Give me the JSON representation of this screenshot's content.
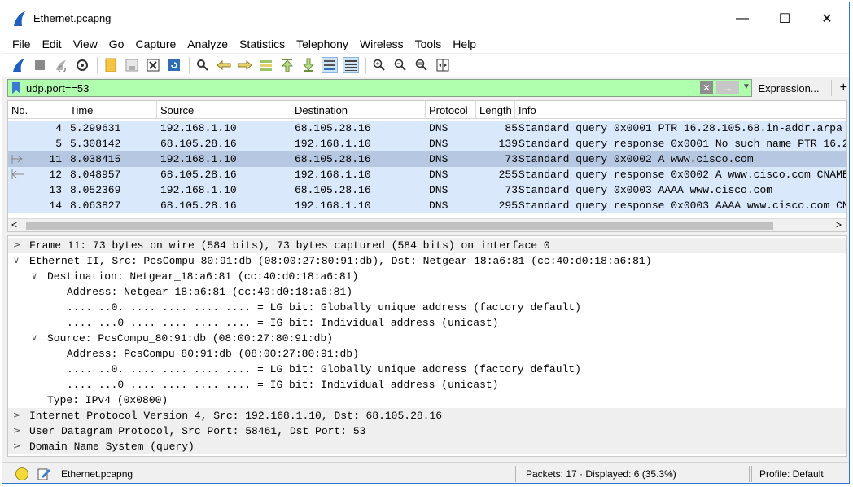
{
  "window": {
    "title": "Ethernet.pcapng",
    "minimize_glyph": "—",
    "maximize_glyph": "☐",
    "close_glyph": "✕"
  },
  "menu": {
    "items": [
      "File",
      "Edit",
      "View",
      "Go",
      "Capture",
      "Analyze",
      "Statistics",
      "Telephony",
      "Wireless",
      "Tools",
      "Help"
    ]
  },
  "toolbar": {
    "icons": [
      "shark-fin-start-icon",
      "stop-icon",
      "restart-icon",
      "capture-options-icon",
      "open-file-icon",
      "save-file-icon",
      "close-file-icon",
      "reload-icon",
      "find-packet-icon",
      "go-back-icon",
      "go-forward-icon",
      "go-to-packet-icon",
      "go-first-icon",
      "go-last-icon",
      "auto-scroll-icon",
      "colorize-icon",
      "zoom-in-icon",
      "zoom-out-icon",
      "normal-size-icon",
      "resize-columns-icon"
    ]
  },
  "filter": {
    "value": "udp.port==53",
    "field_color": "#afffaf",
    "clear_glyph": "✕",
    "apply_glyph": "→",
    "dropdown_glyph": "▼",
    "expression_label": "Expression...",
    "add_glyph": "+"
  },
  "packet_list": {
    "columns": [
      "No.",
      "Time",
      "Source",
      "Destination",
      "Protocol",
      "Length",
      "Info"
    ],
    "row_color": "#dae8fc",
    "selected_color": "#b6c8e1",
    "rows": [
      {
        "no": "4",
        "time": "5.299631",
        "src": "192.168.1.10",
        "dst": "68.105.28.16",
        "proto": "DNS",
        "len": "85",
        "info": "Standard query 0x0001 PTR 16.28.105.68.in-addr.arpa"
      },
      {
        "no": "5",
        "time": "5.308142",
        "src": "68.105.28.16",
        "dst": "192.168.1.10",
        "proto": "DNS",
        "len": "139",
        "info": "Standard query response 0x0001 No such name PTR 16.2"
      },
      {
        "no": "11",
        "time": "8.038415",
        "src": "192.168.1.10",
        "dst": "68.105.28.16",
        "proto": "DNS",
        "len": "73",
        "info": "Standard query 0x0002 A www.cisco.com"
      },
      {
        "no": "12",
        "time": "8.048957",
        "src": "68.105.28.16",
        "dst": "192.168.1.10",
        "proto": "DNS",
        "len": "255",
        "info": "Standard query response 0x0002 A www.cisco.com CNAME"
      },
      {
        "no": "13",
        "time": "8.052369",
        "src": "192.168.1.10",
        "dst": "68.105.28.16",
        "proto": "DNS",
        "len": "73",
        "info": "Standard query 0x0003 AAAA www.cisco.com"
      },
      {
        "no": "14",
        "time": "8.063827",
        "src": "68.105.28.16",
        "dst": "192.168.1.10",
        "proto": "DNS",
        "len": "295",
        "info": "Standard query response 0x0003 AAAA www.cisco.com CN"
      }
    ],
    "scroll_left_glyph": "<",
    "scroll_right_glyph": ">"
  },
  "details": {
    "lines": [
      {
        "toggle": ">",
        "text": "Frame 11: 73 bytes on wire (584 bits), 73 bytes captured (584 bits) on interface 0"
      },
      {
        "toggle": "∨",
        "text": "Ethernet II, Src: PcsCompu_80:91:db (08:00:27:80:91:db), Dst: Netgear_18:a6:81 (cc:40:d0:18:a6:81)"
      },
      {
        "toggle": "∨",
        "text": "Destination: Netgear_18:a6:81 (cc:40:d0:18:a6:81)"
      },
      {
        "toggle": "",
        "text": "Address: Netgear_18:a6:81 (cc:40:d0:18:a6:81)"
      },
      {
        "toggle": "",
        "text": ".... ..0. .... .... .... .... = LG bit: Globally unique address (factory default)"
      },
      {
        "toggle": "",
        "text": ".... ...0 .... .... .... .... = IG bit: Individual address (unicast)"
      },
      {
        "toggle": "∨",
        "text": "Source: PcsCompu_80:91:db (08:00:27:80:91:db)"
      },
      {
        "toggle": "",
        "text": "Address: PcsCompu_80:91:db (08:00:27:80:91:db)"
      },
      {
        "toggle": "",
        "text": ".... ..0. .... .... .... .... = LG bit: Globally unique address (factory default)"
      },
      {
        "toggle": "",
        "text": ".... ...0 .... .... .... .... = IG bit: Individual address (unicast)"
      },
      {
        "toggle": "",
        "text": "Type: IPv4 (0x0800)"
      },
      {
        "toggle": ">",
        "text": "Internet Protocol Version 4, Src: 192.168.1.10, Dst: 68.105.28.16"
      },
      {
        "toggle": ">",
        "text": "User Datagram Protocol, Src Port: 58461, Dst Port: 53"
      },
      {
        "toggle": ">",
        "text": "Domain Name System (query)"
      }
    ]
  },
  "status": {
    "file": "Ethernet.pcapng",
    "packets": "Packets: 17 · Displayed: 6 (35.3%)",
    "profile": "Profile: Default"
  }
}
